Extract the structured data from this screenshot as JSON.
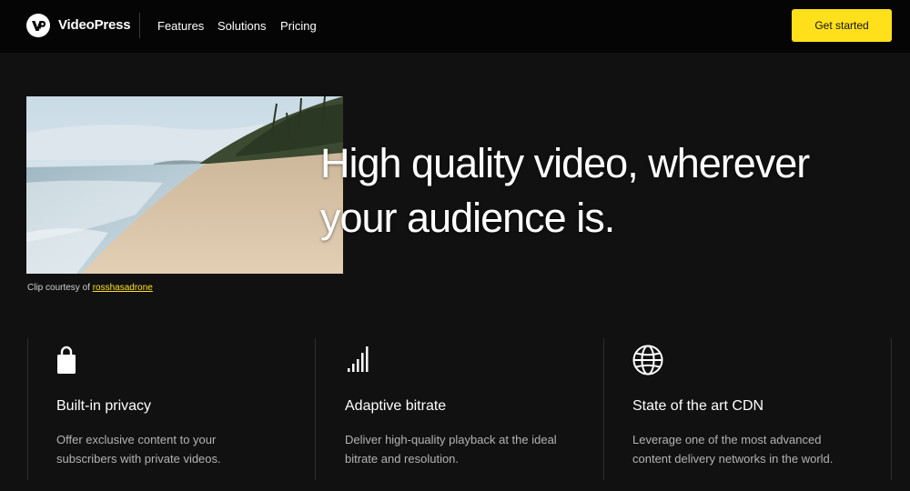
{
  "header": {
    "logo_icon": "videopress-logo-icon",
    "brand": "VideoPress",
    "nav": [
      "Features",
      "Solutions",
      "Pricing"
    ],
    "cta_label": "Get started",
    "cta_color": "#ffe01b"
  },
  "hero": {
    "video_description_icon": "beach-video-thumbnail",
    "caption_prefix": "Clip courtesy of",
    "caption_link": "rosshasadrone",
    "headline_line1": "High quality video, wherever",
    "headline_line2": "your audience is."
  },
  "features": [
    {
      "icon": "lock-icon",
      "title": "Built-in privacy",
      "desc_line1": "Offer exclusive content to your",
      "desc_line2": "subscribers with private videos."
    },
    {
      "icon": "signal-bars-icon",
      "title": "Adaptive bitrate",
      "desc_line1": "Deliver high-quality playback at the ideal",
      "desc_line2": "bitrate and resolution."
    },
    {
      "icon": "globe-icon",
      "title": "State of the art CDN",
      "desc_line1": "Leverage one of the most advanced",
      "desc_line2": "content delivery networks in the world."
    }
  ],
  "colors": {
    "background": "#111111",
    "topbar": "#050505",
    "accent": "#ffe01b",
    "muted_text": "#b3b3b3"
  }
}
